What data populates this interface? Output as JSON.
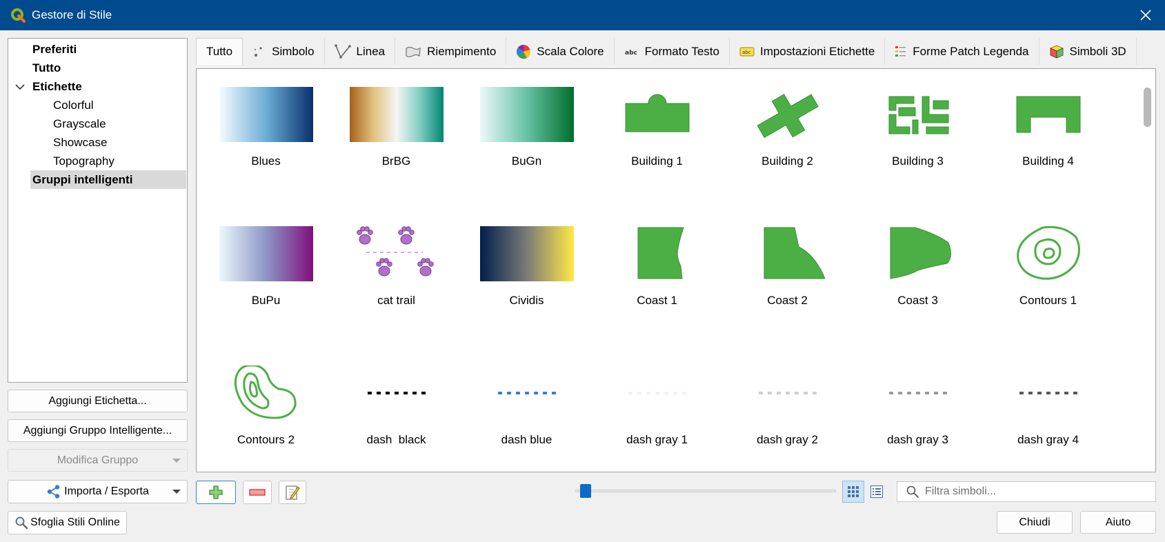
{
  "window": {
    "title": "Gestore di Stile",
    "icon": "qgis-logo-icon"
  },
  "tree": {
    "items": [
      {
        "label": "Preferiti",
        "kind": "bold"
      },
      {
        "label": "Tutto",
        "kind": "bold"
      },
      {
        "label": "Etichette",
        "kind": "bold-expanded"
      },
      {
        "label": "Colorful",
        "kind": "child"
      },
      {
        "label": "Grayscale",
        "kind": "child"
      },
      {
        "label": "Showcase",
        "kind": "child"
      },
      {
        "label": "Topography",
        "kind": "child"
      },
      {
        "label": "Gruppi intelligenti",
        "kind": "bold-selected"
      }
    ]
  },
  "left_buttons": {
    "add_tag": "Aggiungi Etichetta...",
    "add_smart_group": "Aggiungi Gruppo Intelligente...",
    "modify_group": "Modifica Gruppo",
    "import_export": "Importa / Esporta",
    "browse_online": "Sfoglia Stili Online"
  },
  "tabs": [
    {
      "label": "Tutto",
      "icon": "none",
      "active": true
    },
    {
      "label": "Simbolo",
      "icon": "marker-symbol-icon"
    },
    {
      "label": "Linea",
      "icon": "line-symbol-icon"
    },
    {
      "label": "Riempimento",
      "icon": "fill-symbol-icon"
    },
    {
      "label": "Scala Colore",
      "icon": "color-ramp-icon"
    },
    {
      "label": "Formato Testo",
      "icon": "text-format-icon"
    },
    {
      "label": "Impostazioni Etichette",
      "icon": "label-settings-icon"
    },
    {
      "label": "Forme Patch Legenda",
      "icon": "legend-patch-icon"
    },
    {
      "label": "Simboli 3D",
      "icon": "symbol-3d-icon"
    }
  ],
  "symbols": [
    {
      "name": "Blues",
      "type": "ramp",
      "colors": [
        "#f7fbff",
        "#6baed6",
        "#08306b"
      ]
    },
    {
      "name": "BrBG",
      "type": "ramp",
      "colors": [
        "#a6611a",
        "#dfc27d",
        "#f5f5f5",
        "#80cdc1",
        "#018571"
      ]
    },
    {
      "name": "BuGn",
      "type": "ramp",
      "colors": [
        "#edf8fb",
        "#66c2a4",
        "#006d2c"
      ]
    },
    {
      "name": "Building 1",
      "type": "building1"
    },
    {
      "name": "Building 2",
      "type": "building2"
    },
    {
      "name": "Building 3",
      "type": "building3"
    },
    {
      "name": "Building 4",
      "type": "building4"
    },
    {
      "name": "BuPu",
      "type": "ramp",
      "colors": [
        "#edf8fb",
        "#8c96c6",
        "#810f7c"
      ]
    },
    {
      "name": "cat trail",
      "type": "cattrail"
    },
    {
      "name": "Cividis",
      "type": "ramp",
      "colors": [
        "#00204c",
        "#7c7b78",
        "#ffe945"
      ]
    },
    {
      "name": "Coast 1",
      "type": "coast1"
    },
    {
      "name": "Coast 2",
      "type": "coast2"
    },
    {
      "name": "Coast 3",
      "type": "coast3"
    },
    {
      "name": "Contours 1",
      "type": "contours1"
    },
    {
      "name": "Contours 2",
      "type": "contours2"
    },
    {
      "name": "dash  black",
      "type": "dash",
      "color": "#000000"
    },
    {
      "name": "dash blue",
      "type": "dash",
      "color": "#3a7ed3"
    },
    {
      "name": "dash gray 1",
      "type": "dash",
      "color": "#f2f2f2"
    },
    {
      "name": "dash gray 2",
      "type": "dash",
      "color": "#cfcfcf"
    },
    {
      "name": "dash gray 3",
      "type": "dash",
      "color": "#9a9a9a"
    },
    {
      "name": "dash gray 4",
      "type": "dash",
      "color": "#5a5a5a"
    }
  ],
  "colors": {
    "symbol_green": "#4caf45",
    "symbol_green_stroke": "#3a8f34",
    "cat_purple": "#b06fc8",
    "titlebar": "#004b8d"
  },
  "toolbar": {
    "add_icon": "plus-icon",
    "remove_icon": "minus-icon",
    "edit_icon": "edit-icon",
    "zoom_level": 0.02
  },
  "filter": {
    "placeholder": "Filtra simboli..."
  },
  "footer": {
    "close": "Chiudi",
    "help": "Aiuto"
  }
}
